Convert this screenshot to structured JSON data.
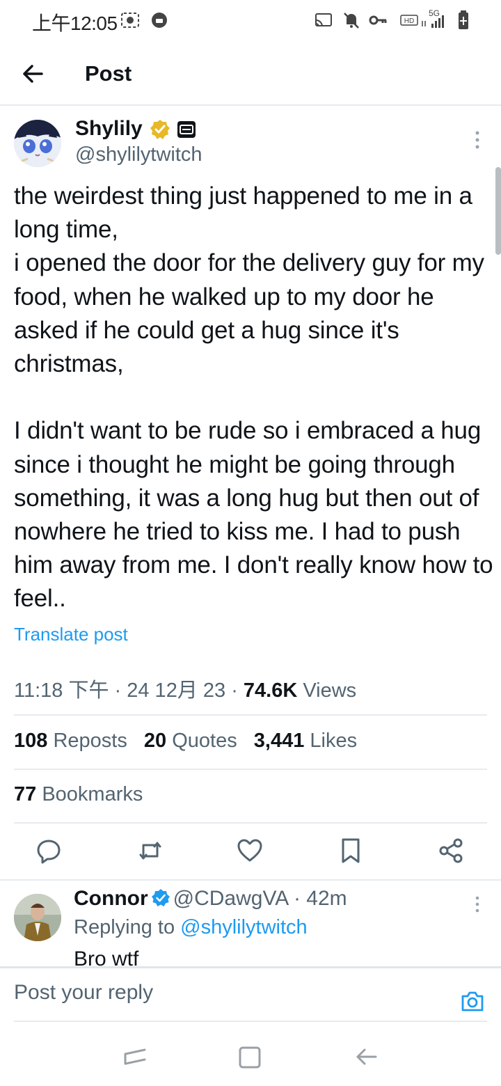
{
  "status_bar": {
    "time": "上午12:05",
    "network": "5G"
  },
  "header": {
    "title": "Post"
  },
  "post": {
    "author_name": "Shylily",
    "author_handle": "@shylilytwitch",
    "text": "the weirdest thing just happened to me in a long time,\ni opened the door for the delivery guy for my food, when he walked up to my door he asked if he could get a hug since it's christmas,\n\nI didn't want to be rude so i embraced a hug since i thought he might be going through something, it was a long hug but then out of nowhere he tried to kiss me. I had to push him away from me. I don't really know how to feel..",
    "translate_label": "Translate post",
    "timestamp": "11:18 下午 · 24 12月 23 · ",
    "views_count": "74.6K",
    "views_label": " Views",
    "reposts_count": "108",
    "reposts_label": " Reposts",
    "quotes_count": "20",
    "quotes_label": " Quotes",
    "likes_count": "3,441",
    "likes_label": " Likes",
    "bookmarks_count": "77",
    "bookmarks_label": " Bookmarks"
  },
  "actions": [
    "reply-icon",
    "repost-icon",
    "like-icon",
    "bookmark-icon",
    "share-icon"
  ],
  "reply": {
    "name": "Connor",
    "handle": "@CDawgVA",
    "time": " · 42m",
    "replying_prefix": "Replying to ",
    "replying_to": "@shylilytwitch",
    "text": "Bro wtf"
  },
  "compose": {
    "placeholder": "Post your reply"
  },
  "colors": {
    "accent": "#1d9bf0",
    "text_primary": "#0f1419",
    "text_secondary": "#536471",
    "gold_verified": "#e8b828"
  }
}
